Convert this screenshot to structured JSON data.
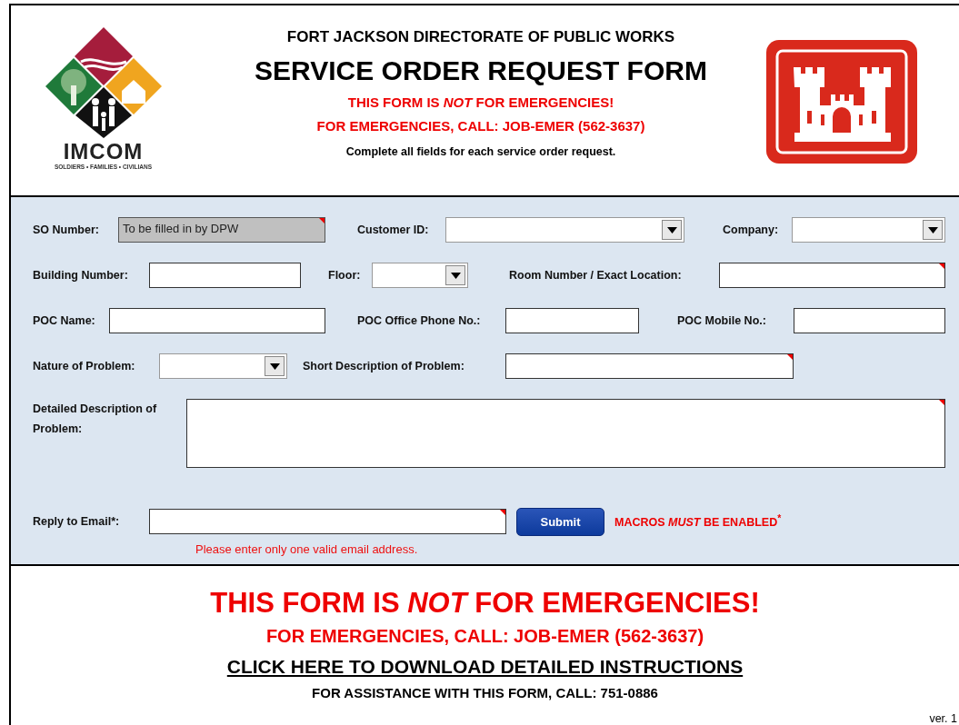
{
  "header": {
    "logo": {
      "name": "IMCOM",
      "tagline": "SOLDIERS • FAMILIES • CIVILIANS"
    },
    "organization": "FORT JACKSON DIRECTORATE OF PUBLIC WORKS",
    "title": "SERVICE ORDER REQUEST FORM",
    "warning": "THIS FORM IS *NOT* FOR EMERGENCIES!",
    "emergency": "FOR EMERGENCIES, CALL: JOB-EMER (562-3637)",
    "instruction": "Complete all fields for each service order request."
  },
  "form": {
    "rows": [
      {
        "fields": [
          {
            "label": "SO Number:",
            "kind": "readonly",
            "value": "To be filled in by DPW",
            "comment": true
          },
          {
            "label": "Customer ID:",
            "kind": "dropdown",
            "comment": false
          },
          {
            "label": "Company:",
            "kind": "dropdown",
            "comment": false
          }
        ]
      },
      {
        "fields": [
          {
            "label": "Building Number:",
            "kind": "text",
            "comment": false
          },
          {
            "label": "Floor:",
            "kind": "dropdown",
            "comment": false
          },
          {
            "label": "Room Number / Exact Location:",
            "kind": "text",
            "comment": true
          }
        ]
      },
      {
        "fields": [
          {
            "label": "POC Name:",
            "kind": "text",
            "comment": false
          },
          {
            "label": "POC Office Phone No.:",
            "kind": "text",
            "comment": false
          },
          {
            "label": "POC Mobile No.:",
            "kind": "text",
            "comment": false
          }
        ]
      },
      {
        "fields": [
          {
            "label": "Nature of Problem:",
            "kind": "dropdown",
            "comment": false
          },
          {
            "label": "Short Description of Problem:",
            "kind": "text",
            "comment": true
          }
        ]
      },
      {
        "fields": [
          {
            "label": "Detailed Description of Problem:",
            "kind": "textarea",
            "comment": true
          }
        ]
      }
    ],
    "email": {
      "label": "Reply to Email*:",
      "comment": true,
      "hint": "Please enter only one valid email address."
    },
    "submit": "Submit",
    "macros_notice": "MACROS *MUST* BE ENABLED$^{*}$"
  },
  "footer": {
    "warning": "THIS FORM IS *NOT* FOR EMERGENCIES!",
    "emergency": "FOR EMERGENCIES, CALL: JOB-EMER (562-3637)",
    "download_link": "CLICK HERE TO DOWNLOAD DETAILED INSTRUCTIONS",
    "assistance": "FOR ASSISTANCE WITH THIS FORM, CALL: 751-0886",
    "version": "ver. 1"
  }
}
